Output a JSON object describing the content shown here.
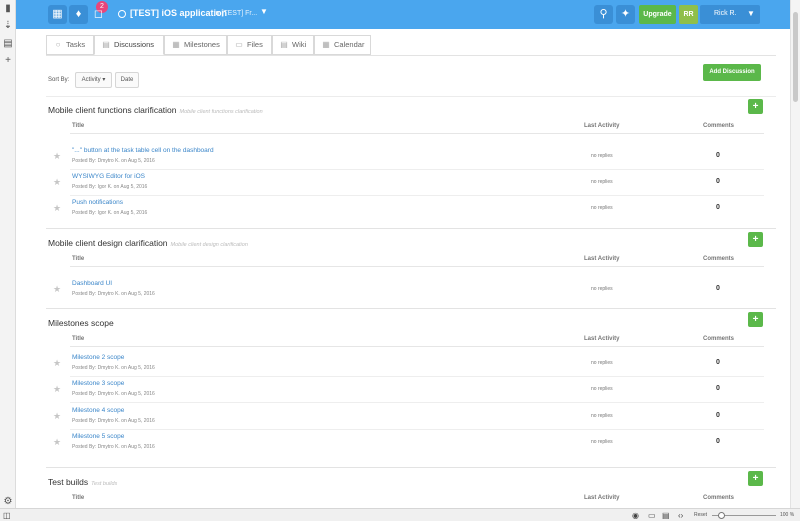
{
  "header": {
    "notifications_count": "2",
    "project_title": "[TEST] iOS application",
    "project_in": "in [TEST] Fr...",
    "upgrade_label": "Upgrade",
    "avatar_initials": "RR",
    "user_name": "Rick R.",
    "accent_color": "#4aa6ee",
    "icons": [
      "grid-icon",
      "bell-icon",
      "bookmark-icon",
      "search-icon",
      "add-spark-icon",
      "chevron-down-icon"
    ]
  },
  "tabs": [
    {
      "label": "Tasks",
      "icon": "check-circle-icon"
    },
    {
      "label": "Discussions",
      "icon": "chat-icon"
    },
    {
      "label": "Milestones",
      "icon": "milestones-icon"
    },
    {
      "label": "Files",
      "icon": "folder-icon"
    },
    {
      "label": "Wiki",
      "icon": "wiki-icon"
    },
    {
      "label": "Calendar",
      "icon": "calendar-icon"
    }
  ],
  "sort": {
    "label": "Sort By:",
    "activity": "Activity ▾",
    "date": "Date"
  },
  "add_discussion_label": "Add Discussion",
  "columns": {
    "title": "Title",
    "last_activity": "Last Activity",
    "comments": "Comments"
  },
  "groups": [
    {
      "title": "Mobile client functions clarification",
      "subtitle": "Mobile client functions clarification",
      "rows": [
        {
          "title": "\"...\" button at the task table cell on the dashboard",
          "meta": "Posted By: Dmytro K. on Aug 5, 2016",
          "activity": "no replies",
          "comments": "0"
        },
        {
          "title": "WYSIWYG Editor for iOS",
          "meta": "Posted By: Igor K. on Aug 5, 2016",
          "activity": "no replies",
          "comments": "0"
        },
        {
          "title": "Push notifications",
          "meta": "Posted By: Igor K. on Aug 5, 2016",
          "activity": "no replies",
          "comments": "0"
        }
      ]
    },
    {
      "title": "Mobile client design clarification",
      "subtitle": "Mobile client design clarification",
      "rows": [
        {
          "title": "Dashboard UI",
          "meta": "Posted By: Dmytro K. on Aug 5, 2016",
          "activity": "no replies",
          "comments": "0"
        }
      ]
    },
    {
      "title": "Milestones scope",
      "subtitle": "",
      "rows": [
        {
          "title": "Milestone 2 scope",
          "meta": "Posted By: Dmytro K. on Aug 5, 2016",
          "activity": "no replies",
          "comments": "0"
        },
        {
          "title": "Milestone 3 scope",
          "meta": "Posted By: Dmytro K. on Aug 5, 2016",
          "activity": "no replies",
          "comments": "0"
        },
        {
          "title": "Milestone 4 scope",
          "meta": "Posted By: Dmytro K. on Aug 5, 2016",
          "activity": "no replies",
          "comments": "0"
        },
        {
          "title": "Milestone 5 scope",
          "meta": "Posted By: Dmytro K. on Aug 5, 2016",
          "activity": "no replies",
          "comments": "0"
        }
      ]
    },
    {
      "title": "Test builds",
      "subtitle": "Test builds",
      "rows": []
    }
  ],
  "statusbar": {
    "zoom_label": "Reset",
    "zoom_percent": "100 %"
  }
}
